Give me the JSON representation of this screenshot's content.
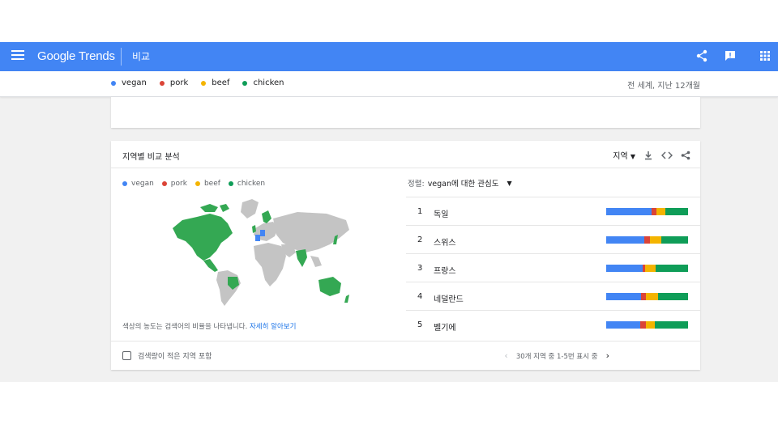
{
  "appbar": {
    "logo": "Google Trends",
    "title": "비교",
    "icons": [
      "menu-icon",
      "share-icon",
      "feedback-icon",
      "apps-icon"
    ]
  },
  "colors": {
    "blue": "#4285f4",
    "red": "#db4437",
    "yellow": "#f4b400",
    "green": "#0f9d58"
  },
  "terms": [
    {
      "label": "vegan",
      "color": "#4285f4"
    },
    {
      "label": "pork",
      "color": "#db4437"
    },
    {
      "label": "beef",
      "color": "#f4b400"
    },
    {
      "label": "chicken",
      "color": "#0f9d58"
    }
  ],
  "scope": "전 세계, 지난 12개월",
  "regional": {
    "title": "지역별 비교 분석",
    "region_select": "지역",
    "sort_label": "정렬:",
    "sort_value": "vegan에 대한 관심도",
    "note": "색상의 농도는 검색어의 비율을 나타냅니다.",
    "note_link": "자세히 알아보기",
    "low_volume_label": "검색량이 적은 지역 포함",
    "pager_text": "30개 지역 중 1-5번 표시 중",
    "rows": [
      {
        "rank": "1",
        "name": "독일",
        "shares": [
          55,
          6,
          11,
          28
        ]
      },
      {
        "rank": "2",
        "name": "스위스",
        "shares": [
          47,
          6,
          14,
          33
        ]
      },
      {
        "rank": "3",
        "name": "프랑스",
        "shares": [
          45,
          3,
          12,
          40
        ]
      },
      {
        "rank": "4",
        "name": "네덜란드",
        "shares": [
          43,
          6,
          14,
          37
        ]
      },
      {
        "rank": "5",
        "name": "벨기에",
        "shares": [
          42,
          7,
          10,
          41
        ]
      }
    ]
  }
}
